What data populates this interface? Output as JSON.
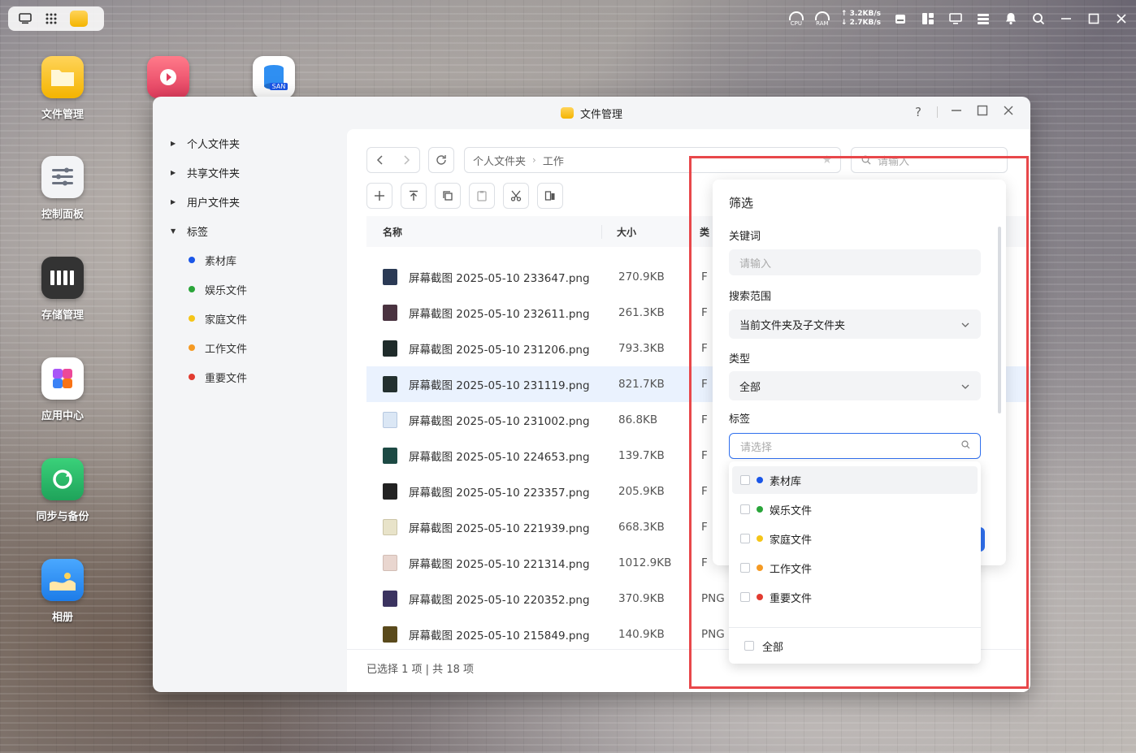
{
  "taskbar": {
    "cpu_label": "CPU",
    "ram_label": "RAM",
    "net_up": "↑ 3.2KB/s",
    "net_down": "↓ 2.7KB/s"
  },
  "desktop_icons": [
    {
      "label": "文件管理"
    },
    {
      "label": "控制面板"
    },
    {
      "label": "存储管理"
    },
    {
      "label": "应用中心"
    },
    {
      "label": "同步与备份"
    },
    {
      "label": "相册"
    }
  ],
  "san_badge": "SAN",
  "window": {
    "title": "文件管理",
    "help": "?"
  },
  "sidebar": {
    "groups": [
      {
        "label": "个人文件夹"
      },
      {
        "label": "共享文件夹"
      },
      {
        "label": "用户文件夹"
      },
      {
        "label": "标签"
      }
    ],
    "tags": [
      {
        "label": "素材库",
        "color": "#1a56e8"
      },
      {
        "label": "娱乐文件",
        "color": "#2aa53a"
      },
      {
        "label": "家庭文件",
        "color": "#f5c518"
      },
      {
        "label": "工作文件",
        "color": "#f59a23"
      },
      {
        "label": "重要文件",
        "color": "#e23b30"
      }
    ]
  },
  "breadcrumb": {
    "root": "个人文件夹",
    "current": "工作"
  },
  "search": {
    "placeholder": "请输入"
  },
  "table": {
    "headers": {
      "name": "名称",
      "size": "大小",
      "type": "类"
    },
    "rows": [
      {
        "name": "屏幕截图 2025-05-10 233647.png",
        "size": "270.9KB",
        "type": "F",
        "thumb": "#2b3a55"
      },
      {
        "name": "屏幕截图 2025-05-10 232611.png",
        "size": "261.3KB",
        "type": "F",
        "thumb": "#4a3340"
      },
      {
        "name": "屏幕截图 2025-05-10 231206.png",
        "size": "793.3KB",
        "type": "F",
        "thumb": "#1f2b2a"
      },
      {
        "name": "屏幕截图 2025-05-10 231119.png",
        "size": "821.7KB",
        "type": "F",
        "thumb": "#23302f"
      },
      {
        "name": "屏幕截图 2025-05-10 231002.png",
        "size": "86.8KB",
        "type": "F",
        "thumb": "#dbe7f5"
      },
      {
        "name": "屏幕截图 2025-05-10 224653.png",
        "size": "139.7KB",
        "type": "F",
        "thumb": "#1d4a44"
      },
      {
        "name": "屏幕截图 2025-05-10 223357.png",
        "size": "205.9KB",
        "type": "F",
        "thumb": "#222222"
      },
      {
        "name": "屏幕截图 2025-05-10 221939.png",
        "size": "668.3KB",
        "type": "F",
        "thumb": "#e8e3c9"
      },
      {
        "name": "屏幕截图 2025-05-10 221314.png",
        "size": "1012.9KB",
        "type": "F",
        "thumb": "#e9d6cf"
      },
      {
        "name": "屏幕截图 2025-05-10 220352.png",
        "size": "370.9KB",
        "type": "PNG",
        "thumb": "#3b3360"
      },
      {
        "name": "屏幕截图 2025-05-10 215849.png",
        "size": "140.9KB",
        "type": "PNG",
        "thumb": "#5a4a1c"
      }
    ]
  },
  "status": "已选择 1 项 | 共 18 项",
  "filter": {
    "title": "筛选",
    "keyword_label": "关键词",
    "keyword_placeholder": "请输入",
    "scope_label": "搜索范围",
    "scope_value": "当前文件夹及子文件夹",
    "type_label": "类型",
    "type_value": "全部",
    "tag_label": "标签",
    "tag_placeholder": "请选择",
    "tag_options": [
      {
        "label": "素材库",
        "color": "#1a56e8"
      },
      {
        "label": "娱乐文件",
        "color": "#2aa53a"
      },
      {
        "label": "家庭文件",
        "color": "#f5c518"
      },
      {
        "label": "工作文件",
        "color": "#f59a23"
      },
      {
        "label": "重要文件",
        "color": "#e23b30"
      }
    ],
    "all_label": "全部"
  }
}
